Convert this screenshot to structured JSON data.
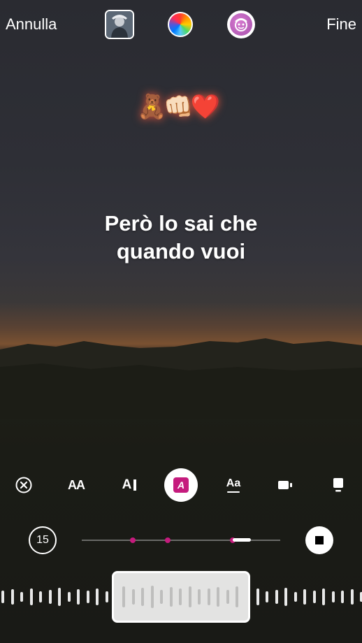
{
  "topbar": {
    "cancel_label": "Annulla",
    "done_label": "Fine",
    "album_icon": "album-cover-thumbnail",
    "color_icon": "color-wheel-icon",
    "effect_icon": "face-filter-icon"
  },
  "stickers": [
    "🧸",
    "👊🏻",
    "❤️"
  ],
  "lyrics": {
    "line1": "Però lo sai che",
    "line2": "quando vuoi"
  },
  "tools": [
    {
      "name": "close-circle-icon",
      "active": false
    },
    {
      "name": "text-size-icon",
      "label": "AA",
      "active": false
    },
    {
      "name": "text-style-icon",
      "label": "A",
      "active": false
    },
    {
      "name": "text-highlight-icon",
      "label": "A",
      "active": true
    },
    {
      "name": "text-font-icon",
      "label": "Aa",
      "active": false
    },
    {
      "name": "video-camera-icon",
      "active": false
    },
    {
      "name": "card-style-icon",
      "active": false
    }
  ],
  "playback": {
    "duration_label": "15",
    "stop_icon": "stop-icon"
  },
  "colors": {
    "accent": "#c51b7d",
    "white": "#ffffff"
  }
}
